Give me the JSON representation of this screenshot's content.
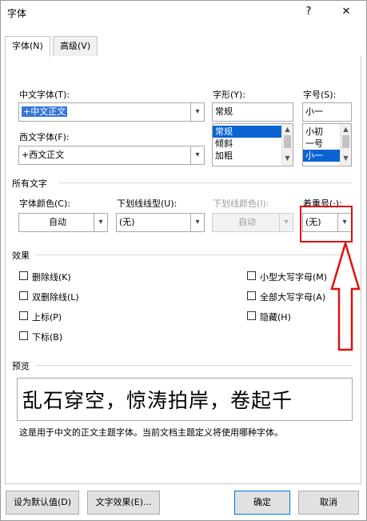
{
  "dialog": {
    "title": "字体",
    "help_label": "?",
    "close_label": "✕"
  },
  "tabs": [
    {
      "label": "字体(N)"
    },
    {
      "label": "高级(V)"
    }
  ],
  "font": {
    "chinese_font_label": "中文字体(T):",
    "chinese_font_value": "+中文正文",
    "western_font_label": "西文字体(F):",
    "western_font_value": "+西文正文",
    "style_label": "字形(Y):",
    "style_value": "常规",
    "style_options": [
      "常规",
      "倾斜",
      "加粗"
    ],
    "size_label": "字号(S):",
    "size_value": "小一",
    "size_options": [
      "小初",
      "一号",
      "小一"
    ]
  },
  "all_text": {
    "section_label": "所有文字",
    "color_label": "字体颜色(C):",
    "color_value": "自动",
    "underline_label": "下划线线型(U):",
    "underline_value": "(无)",
    "underline_color_label": "下划线颜色(I):",
    "underline_color_value": "自动",
    "emphasis_label": "着重号(·):",
    "emphasis_value": "(无)"
  },
  "effects": {
    "section_label": "效果",
    "left": [
      "删除线(K)",
      "双删除线(L)",
      "上标(P)",
      "下标(B)"
    ],
    "right": [
      "小型大写字母(M)",
      "全部大写字母(A)",
      "隐藏(H)"
    ]
  },
  "preview": {
    "section_label": "预览",
    "sample_text": "乱石穿空，惊涛拍岸，卷起千",
    "description": "这是用于中文的正文主题字体。当前文档主题定义将使用哪种字体。"
  },
  "buttons": {
    "set_default": "设为默认值(D)",
    "text_effects": "文字效果(E)...",
    "ok": "确定",
    "cancel": "取消"
  },
  "icons": {
    "dropdown_arrow": "chevron-down-icon",
    "scroll_up": "triangle-up",
    "scroll_down": "triangle-down"
  },
  "colors": {
    "annotation_red": "#e01010",
    "selection_blue": "#0a64d2",
    "primary_border": "#0078d7"
  }
}
